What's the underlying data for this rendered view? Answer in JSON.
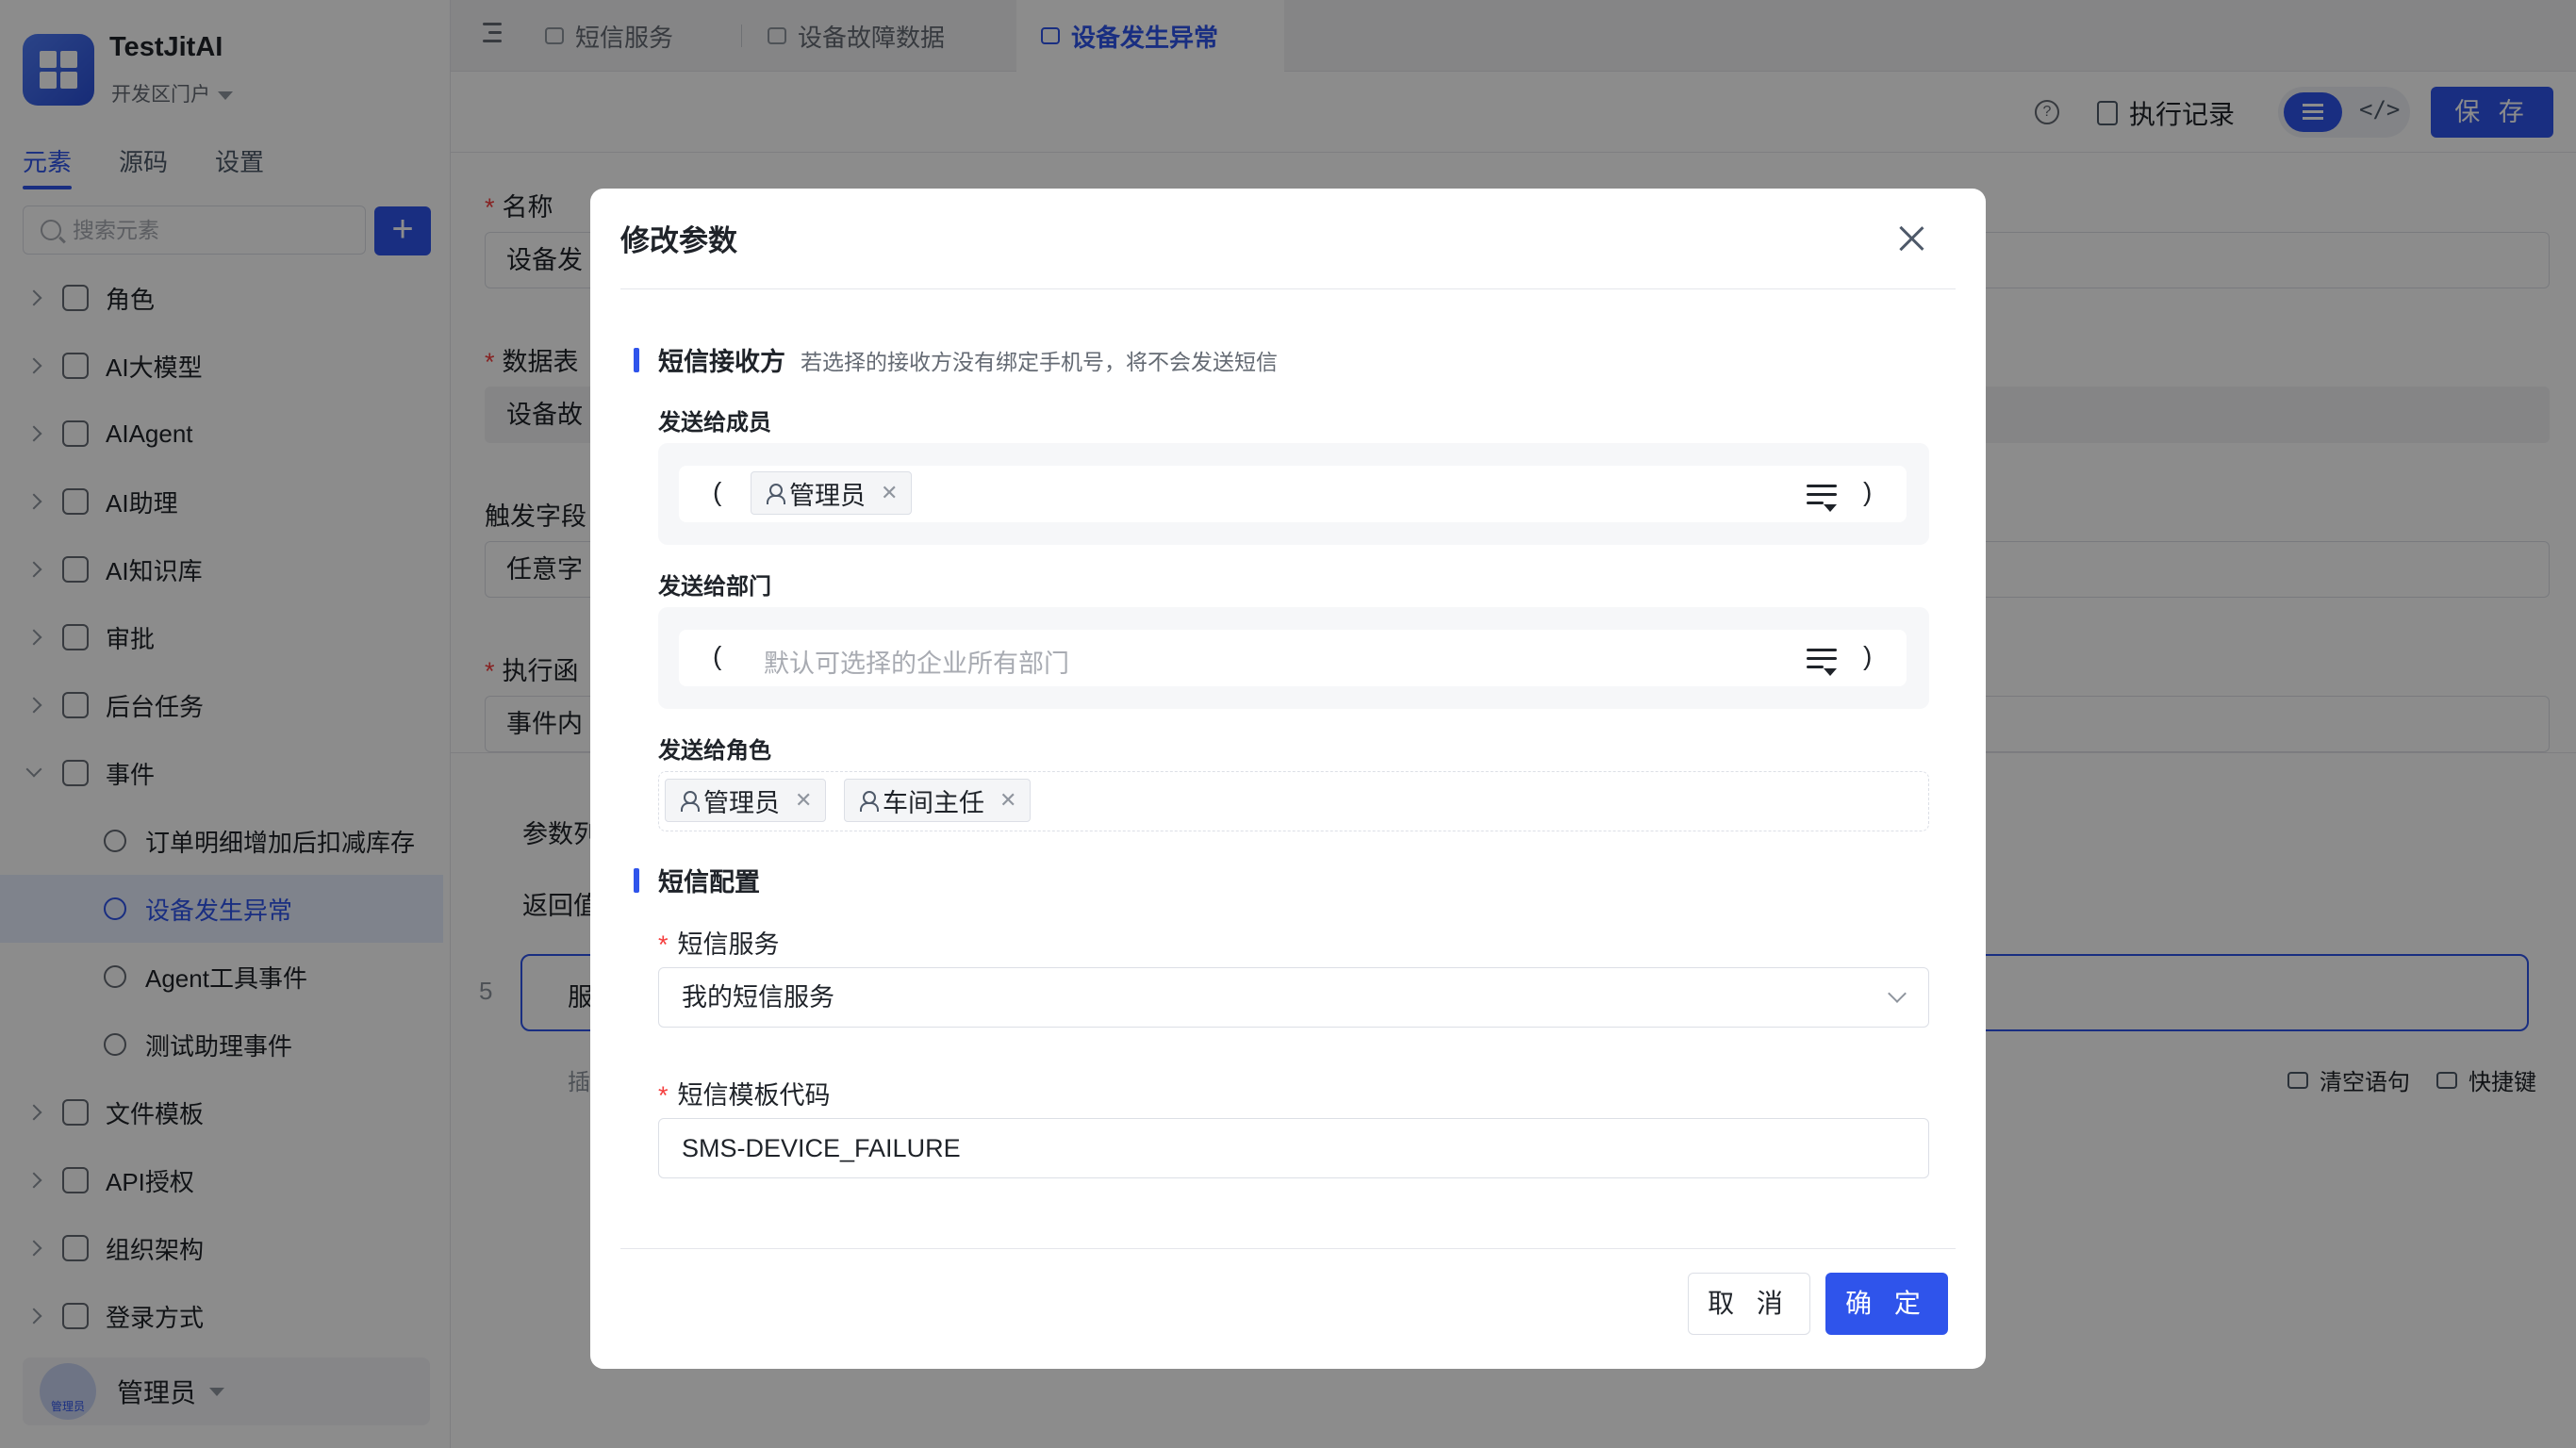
{
  "app": {
    "name": "TestJitAI",
    "portal": "开发区门户"
  },
  "sidebar": {
    "tabs": [
      "元素",
      "源码",
      "设置"
    ],
    "search_placeholder": "搜索元素",
    "add_label": "+",
    "items": [
      {
        "label": "角色",
        "icon": "role-icon"
      },
      {
        "label": "AI大模型",
        "icon": "ai-model-icon"
      },
      {
        "label": "AIAgent",
        "icon": "robot-icon"
      },
      {
        "label": "AI助理",
        "icon": "ai-assistant-icon"
      },
      {
        "label": "AI知识库",
        "icon": "knowledge-base-icon"
      },
      {
        "label": "审批",
        "icon": "approval-icon"
      },
      {
        "label": "后台任务",
        "icon": "task-icon"
      },
      {
        "label": "事件",
        "icon": "event-icon"
      }
    ],
    "event_children": [
      {
        "label": "订单明细增加后扣减库存",
        "icon": "event-icon"
      },
      {
        "label": "设备发生异常",
        "icon": "event-icon"
      },
      {
        "label": "Agent工具事件",
        "icon": "ai-event-icon"
      },
      {
        "label": "测试助理事件",
        "icon": "ai-event-icon"
      }
    ],
    "items_after": [
      {
        "label": "文件模板",
        "icon": "file-template-icon"
      },
      {
        "label": "API授权",
        "icon": "api-icon"
      },
      {
        "label": "组织架构",
        "icon": "org-icon"
      },
      {
        "label": "登录方式",
        "icon": "login-icon"
      }
    ],
    "user": {
      "name": "管理员",
      "avatar_caption": "管理员"
    }
  },
  "tabs": [
    {
      "label": "短信服务"
    },
    {
      "label": "设备故障数据"
    },
    {
      "label": "设备发生异常"
    }
  ],
  "toolbar": {
    "exec_record": "执行记录",
    "code_icon": "</>",
    "save": "保 存"
  },
  "form": {
    "name_label": "名称",
    "name_value": "设备发",
    "table_label": "数据表",
    "table_value": "设备故",
    "trigger_label": "触发字段",
    "trigger_value": "任意字",
    "exec_label": "执行函",
    "exec_value": "事件内",
    "param_label": "参数列",
    "return_label": "返回值",
    "line_num": "5",
    "code_text": "服",
    "hint": "插",
    "clear_label": "清空语句",
    "shortcut_label": "快捷键"
  },
  "modal": {
    "title": "修改参数",
    "section1": {
      "title": "短信接收方",
      "subtitle": "若选择的接收方没有绑定手机号，将不会发送短信"
    },
    "members_label": "发送给成员",
    "member_tag": "管理员",
    "dept_label": "发送给部门",
    "dept_placeholder": "默认可选择的企业所有部门",
    "roles_label": "发送给角色",
    "role_tags": [
      "管理员",
      "车间主任"
    ],
    "paren_open": "(",
    "paren_close": ")",
    "section2": {
      "title": "短信配置"
    },
    "sms_service_label": "短信服务",
    "sms_service_value": "我的短信服务",
    "template_label": "短信模板代码",
    "template_value": "SMS-DEVICE_FAILURE",
    "cancel": "取 消",
    "confirm": "确 定"
  },
  "colors": {
    "primary": "#2f54eb",
    "required": "#f53f3f",
    "mask": "rgba(0,0,0,0.45)"
  }
}
